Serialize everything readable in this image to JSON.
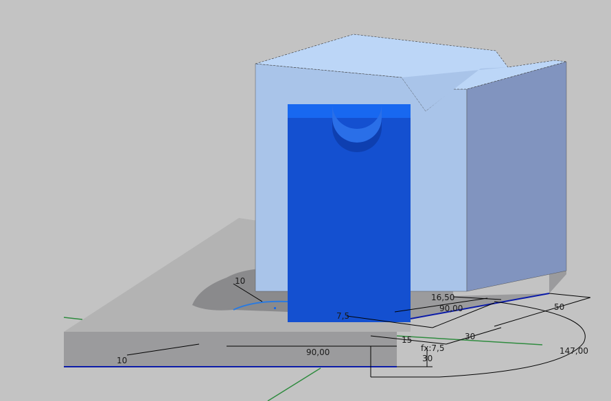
{
  "viewport": {
    "background": "#c3c3c3",
    "colors": {
      "part_blue": "#1450d0",
      "part_blue_top": "#1868f0",
      "block_front": "#a9c4e9",
      "block_top": "#bcd6f7",
      "block_side": "#8194bf",
      "plate_top": "#b3b3b3",
      "plate_front": "#9b9b9d",
      "axis_green": "#2e8b3e",
      "edge_blue": "#0a1aa8"
    }
  },
  "dimensions": {
    "pocket_radius": "10",
    "plate_edge": "10",
    "offset_a": "7,5",
    "offset_b": "16,50",
    "width_top": "90,00",
    "width_bottom": "90,00",
    "depth": "50",
    "length": "30",
    "height_a": "15",
    "fx": "fx:7,5",
    "height_b": "30",
    "overall": "147,00"
  }
}
